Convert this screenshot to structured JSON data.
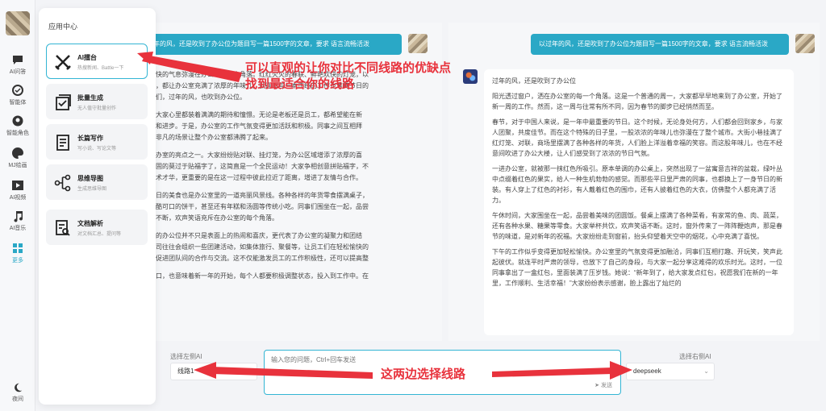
{
  "rail": {
    "items": [
      {
        "label": "AI问答",
        "icon": "chat-icon"
      },
      {
        "label": "智能体",
        "icon": "agent-icon"
      },
      {
        "label": "智能角色",
        "icon": "role-icon"
      },
      {
        "label": "MJ绘画",
        "icon": "paint-icon"
      },
      {
        "label": "AI视频",
        "icon": "video-icon"
      },
      {
        "label": "AI音乐",
        "icon": "music-icon"
      },
      {
        "label": "更多",
        "icon": "more-icon"
      }
    ],
    "night_label": "夜间"
  },
  "panel": {
    "title": "应用中心",
    "apps": [
      {
        "name": "AI擂台",
        "desc": "热搜新闻、Battle一下",
        "icon": "battle-icon"
      },
      {
        "name": "批量生成",
        "desc": "无人值守批量创作",
        "icon": "batch-icon"
      },
      {
        "name": "长篇写作",
        "desc": "写小说、写论文等",
        "icon": "document-icon"
      },
      {
        "name": "思维导图",
        "desc": "生成思维导图",
        "icon": "mindmap-icon"
      },
      {
        "name": "文档解析",
        "desc": "对文档汇总、提问等",
        "icon": "doc-parse-icon"
      }
    ]
  },
  "left": {
    "question": "年的风，还是吹到了办公位为题目写一篇1500字的文章，要求 语言流畅活泼",
    "answer": [
      "快的气息弥漫在办公室的每个角落。红红火火的春联、鲜艳欢快的灯笼，以",
      "，都让办公室充满了浓厚的年味儿。就连那些一本正经的工作也难掩节日的",
      "们，过年的风，也吹到办公位。",
      "大家心里都装着满满的期待和憧憬。无论是老板还是员工，都希望能在新",
      "和进步。于是，办公室的工作气氛变得更加活跃和积极。同事之间互相拜",
      "非凡的场景让整个办公室都沸腾了起来。",
      "办室的亮点之一。大家纷纷贴对联、挂灯笼，为办公区域增添了浓厚的喜",
      "固的莫过于贴福字了，这简直是一个全民运动！大家争相创意拼贴福字，不",
      "术才华，更重要的是在这一过程中彼此拉近了距离，增进了友情与合作。",
      "日的美食也是办公室里的一道亮丽风景线。各种各样的年货零食摆满桌子，",
      "酷可口的饼干，甚至还有年糕和汤圆等传统小吃。同事们围坐在一起，品尝",
      "不断，欢声笑语充斥在办公室的每个角落。",
      "的办公位并不只是表面上的热闹和喜庆，更代表了办公室的凝聚力和团结",
      "司往往会组织一些团建活动，如集体旅行、聚餐等，让员工们在轻松愉快的",
      "促进团队间的合作与交流。这不仅能激发员工的工作积极性，还可以提高整",
      "口，也意味着新一年的开始，每个人都要积极调整状态，投入到工作中。在"
    ]
  },
  "right": {
    "question": "以过年的风，还是吹到了办公位为题目写一篇1500字的文章，要求 语言流畅活泼",
    "title": "过年的风，还是吹到了办公位",
    "paragraphs": [
      "阳光透过窗户，洒在办公室的每一个角落。这是一个普通的周一，大家都早早地来到了办公室，开始了新一周的工作。然而，这一周与往常有所不同，因为春节的脚步已经悄然而至。",
      "春节，对于中国人来说，是一年中最重要的节日。这个时候，无论身处何方，人们都会回到家乡，与家人团聚，共度佳节。而在这个特殊的日子里，一股浓浓的年味儿也弥漫在了整个城市。大街小巷挂满了红灯笼、对联，商场里摆满了各种各样的年货，人们脸上洋溢着幸福的笑容。而这股年味儿，也在不经意间吹进了办公大楼，让人们感受到了浓浓的节日气氛。",
      "一进办公室，就被那一抹红色所吸引。原本单调的办公桌上，突然出现了一盆寓意吉祥的盆栽，绿叶丛中点缀着红色的果实，给人一种生机勃勃的感觉。而那些平日里严肃的同事，也都换上了一身节日的新装。有人穿上了红色的衬衫，有人戴着红色的围巾，还有人披着红色的大衣，仿佛整个人都充满了活力。",
      "午休时间，大家围坐在一起，品尝着美味的团圆饭。餐桌上摆满了各种菜肴，有家常的鱼、肉、蔬菜，还有各种水果、糖果等零食。大家举杯共饮，欢声笑语不断。这时，窗外传来了一阵阵鞭炮声，那是春节的味道，是对新年的祝福。大家纷纷走到窗前，抬头仰望着天空中的烟花，心中充满了喜悦。",
      "下午的工作似乎变得更加轻松愉快。办公室里的气氛变得更加融洽，同事们互相打趣、开玩笑，笑声此起彼伏。就连平时严肃的领导，也放下了自己的身段，与大家一起分享这难得的欢乐时光。这时，一位同事拿出了一盒红包，里面装满了压岁钱。她说：“新年到了，给大家发点红包，祝愿我们在新的一年里，工作顺利、生活幸福！”大家纷纷表示感谢，脸上露出了灿烂的"
    ]
  },
  "bottom": {
    "left_label": "选择左侧AI",
    "left_value": "线路1",
    "right_label": "选择右侧AI",
    "right_value": "deepseek",
    "input_placeholder": "输入您的问题，Ctrl+回车发送",
    "send_label": "发送"
  },
  "annotations": {
    "top_line1": "可以直观的让你对比不同线路的优缺点",
    "top_line2": "找到最适合你的线路",
    "bottom": "这两边选择线路",
    "color": "#e8323c"
  },
  "colors": {
    "accent": "#2aa8c6"
  }
}
